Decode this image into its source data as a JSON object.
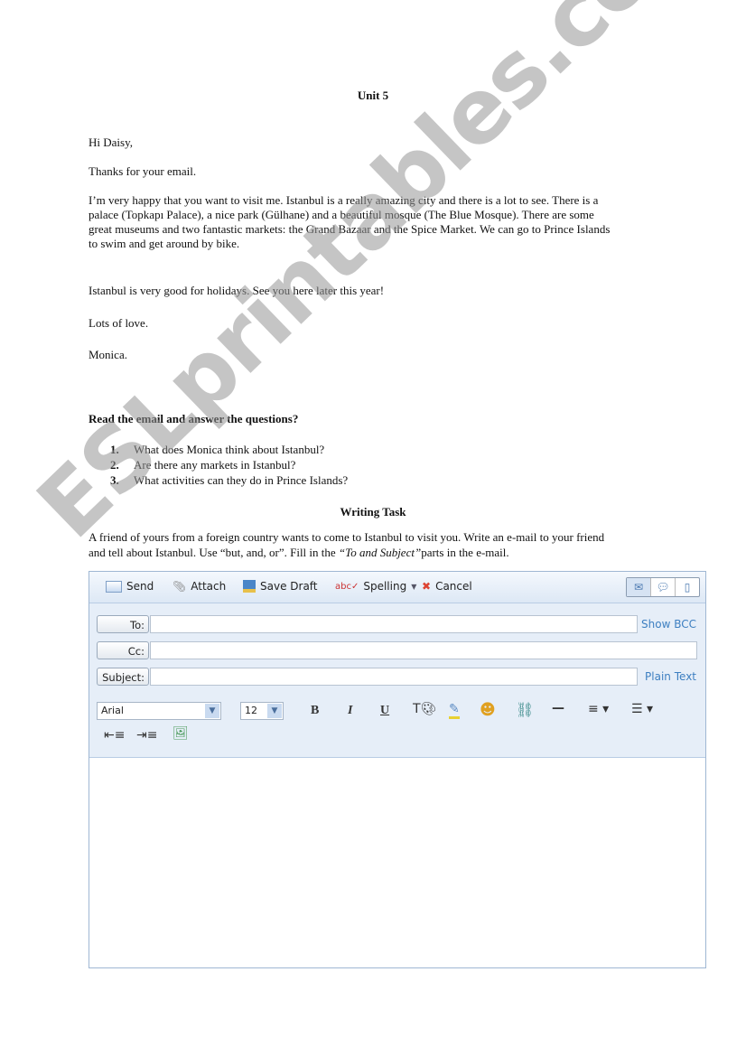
{
  "title": "Unit 5",
  "email": {
    "greeting": "Hi Daisy,",
    "line1": "Thanks for your email.",
    "para": [
      "I’m very happy that you want to visit me. Istanbul is a really amazing city and there is a lot to see. There is a",
      "palace (Topkapı Palace), a nice park (Gülhane) and a beautiful mosque (The Blue Mosque). There are some",
      "great museums and two fantastic markets: the Grand Bazaar and the Spice Market. We can go to Prince Islands",
      "to swim and get around by bike."
    ],
    "line2": "Istanbul is very good for holidays.  See you here later this year!",
    "closing": "Lots of love.",
    "signature": "Monica."
  },
  "questions": {
    "heading": "Read the email and answer the questions?",
    "items": [
      {
        "num": "1.",
        "text": "What does Monica think about Istanbul?"
      },
      {
        "num": "2.",
        "text": "Are there any markets in Istanbul?"
      },
      {
        "num": "3.",
        "text": "What activities can they do in Prince Islands?"
      }
    ]
  },
  "writing": {
    "heading": "Writing Task",
    "line1": "A friend of yours from a foreign country wants to come to Istanbul to visit you.  Write an e-mail to your friend",
    "line2a": "and tell about Istanbul. Use “but, and, or”. Fill in the ",
    "line2b": "“To and Subject”",
    "line2c": "parts in the e-mail."
  },
  "composer": {
    "toolbar": {
      "send": "Send",
      "attach": "Attach",
      "save_draft": "Save Draft",
      "spelling": "Spelling",
      "cancel": "Cancel"
    },
    "to_label": "To:",
    "cc_label": "Cc:",
    "subject_label": "Subject:",
    "to_value": "",
    "cc_value": "",
    "subject_value": "",
    "show_bcc": "Show BCC",
    "plain_text": "Plain Text",
    "font": "Arial",
    "size": "12",
    "format": {
      "bold": "B",
      "italic": "I",
      "underline": "U"
    },
    "accent": "#3d7fc1"
  },
  "watermark": "ESLprintables.com"
}
